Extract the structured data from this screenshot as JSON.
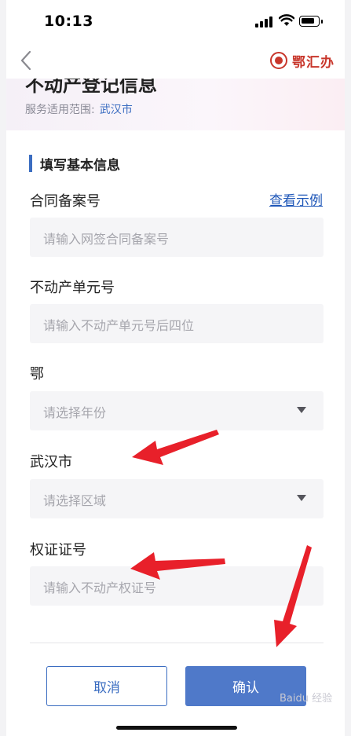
{
  "status_bar": {
    "time": "10:13"
  },
  "nav": {
    "brand_name": "鄂汇办"
  },
  "banner": {
    "title": "不动产登记信息",
    "scope_label": "服务适用范围:",
    "scope_city": "武汉市"
  },
  "section": {
    "title": "填写基本信息"
  },
  "form": {
    "contract_label": "合同备案号",
    "example_link": "查看示例",
    "contract_placeholder": "请输入网签合同备案号",
    "unit_label": "不动产单元号",
    "unit_placeholder": "请输入不动产单元号后四位",
    "year_label": "鄂",
    "year_placeholder": "请选择年份",
    "area_label": "武汉市",
    "area_placeholder": "请选择区域",
    "cert_label": "权证证号",
    "cert_placeholder": "请输入不动产权证号"
  },
  "actions": {
    "cancel": "取消",
    "confirm": "确认"
  },
  "watermark": "Baidu 经验",
  "colors": {
    "accent": "#3b6dc1",
    "brand": "#c8362b",
    "annotation": "#e8202a"
  }
}
